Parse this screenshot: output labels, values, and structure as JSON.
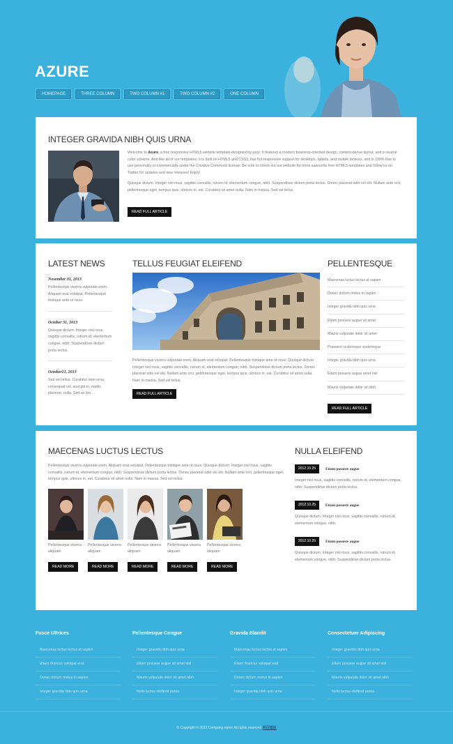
{
  "header": {
    "logo": "AZURE",
    "nav": [
      "HOMEPAGE",
      "THREE COLUMN",
      "TWO COLUMN #1",
      "TWO COLUMN #2",
      "ONE COLUMN"
    ]
  },
  "intro": {
    "title": "INTEGER GRAVIDA NIBH QUIS URNA",
    "p1_lead": "Welcome to ",
    "p1_brand": "Azure",
    "p1_rest": ", a free responsive HTML5 website template designed by zzzz. It features a modern business-oriented design, content-dense layout, and a neutral color scheme. And like all of our templates, it is built on HTML5 and CSS3, has full-responsive support for desktops, tablets, and mobile devices, and is 100% free to use personally or commercially under the Creative Commons license. Be sure to check out our website for more awesome free HTML5 templates and follow us on Twitter for updates and new releases! Enjoy!",
    "p2": "Quisque dictum. Integer nisl risus, sagittis convallis, rutrum id, elementum congue, nibh. Suspendisse dictum porta lectus. Donec placerat odio vel elit. Nullam ante orci, pellentesque eget, tempus quis, ultrices in, est. Curabitur sit amet nulla. Nam in massa. Sed vel tellus.",
    "button": "READ FULL ARTICLE"
  },
  "latest_news": {
    "title": "LATEST NEWS",
    "items": [
      {
        "date": "November 01, 2013",
        "text": "Pellentesque viverra vulputate enim. Aliquam erat volutpat. Pellentesque tristique ante ut risus."
      },
      {
        "date": "October 31, 2013",
        "text": "Quisque dictum. Integer nisl risus, sagittis convallis, rutrum id, elementum congue, nibh. Suspendisse dictum porta lectus."
      },
      {
        "date": "October21, 2013",
        "text": "Sed vel tellus. Curabitur sem urna, consequat vel, suscipit in, mattis placerat, nulla. Sed ac leo."
      }
    ]
  },
  "feature": {
    "title": "TELLUS FEUGIAT ELEIFEND",
    "text": "Pellentesque viverra vulputate enim. Aliquam erat volutpat. Pellentesque tristique ante ut risus. Quisque dictum. Integer nisl risus, sagittis convallis, rutrum id, elementum congue, nibh. Suspendisse dictum porta lectus. Donec placerat odio vel elit. Nullam ante orci, pellentesque eget, tempus quis, ultrices in, est. Curabitur sit amet nulla. Nam in massa. Sed vel tellus.",
    "button": "READ FULL ARTICLE"
  },
  "pellentesque": {
    "title": "PELLENTESQUE",
    "items": [
      "Maecenas luctus lectus at sapien",
      "Donec dictum metus in sapien",
      "Integer gravida nibh quis urna",
      "Etiam posuere augue sit amet",
      "Mauris vulputate dolor sit amet",
      "Praesent scelerisque scelerisque",
      "Integer gravida nibh quis urna",
      "Etiam posuere augue amet nisl",
      "Mauris vulputate dolor sit nibh"
    ],
    "button": "READ FULL ARTICLE"
  },
  "maecenas": {
    "title": "MAECENAS LUCTUS LECTUS",
    "text": "Pellentesque viverra vulputate enim. Aliquam erat volutpat. Pellentesque tristique ante ut risus. Quisque dictum. Integer nisl risus, sagittis convallis, rutrum id, elementum congue, nibh. Suspendisse dictum porta lectus. Donec placerat odio vel elit. Nullam ante orci, pellentesque eget, tempus quis, ultrices in, est. Curabitur sit amet nulla. Nam in massa. Sed vel tellus.",
    "thumbs": [
      {
        "caption": "Pellentesque viverra aliquam",
        "button": "READ MORE"
      },
      {
        "caption": "Pellentesque viverra aliquam",
        "button": "READ MORE"
      },
      {
        "caption": "Pellentesque viverra aliquam",
        "button": "READ MORE"
      },
      {
        "caption": "Pellentesque viverra aliquam",
        "button": "READ MORE"
      },
      {
        "caption": "Pellentesque viverra aliquam",
        "button": "READ MORE"
      }
    ]
  },
  "nulla": {
    "title": "NULLA ELEIFEND",
    "events": [
      {
        "date": "2012.10.25",
        "title": "Etiam posuere augue",
        "text": "Integer nisl risus, sagittis convallis, rutrum id, elementum congue, nibh. Suspendisse dictum porta lectus."
      },
      {
        "date": "2012.10.25",
        "title": "Etiam posuere augue",
        "text": "Quisque dictum. Integer nisl risus, sagittis convallis, rutrum id, elementum congue, nibh."
      },
      {
        "date": "2012.10.25",
        "title": "Etiam posuere augue",
        "text": "Quisque dictum. Integer nisl risus, sagittis convallis, rutrum id, elementum congue, nibh. Suspendisse dictum porta lectus."
      }
    ]
  },
  "footer": {
    "columns": [
      {
        "title": "Fusce Ultrices",
        "items": [
          "Maecenas luctus lectus at sapien",
          "Etiam rhoncus volutpat erat",
          "Donec dictum metus in sapien",
          "Integer gravida nibh quis urna"
        ]
      },
      {
        "title": "Pellentesque Congue",
        "items": [
          "Integer gravida nibh quis urna",
          "Etiam posuere augue sit amet nisl",
          "Mauris vulputate dolor sit amet nibh",
          "Nulla luctus eleifend purus"
        ]
      },
      {
        "title": "Gravida Blandit",
        "items": [
          "Maecenas luctus lectus at sapien",
          "Etiam rhoncus volutpat erat",
          "Donec dictum metus in sapien",
          "Integer gravida nibh quis urna"
        ]
      },
      {
        "title": "Consectetuer Adipiscing",
        "items": [
          "Integer gravida nibh quis urna",
          "Etiam posuere augue sit amet nisl",
          "Mauris vulputate dolor sit amet nibh",
          "Nulla luctus eleifend purus"
        ]
      }
    ],
    "copyright": "© Copyright © 2013 Company name All rights reserved ",
    "copyright_link": "网页模板"
  }
}
